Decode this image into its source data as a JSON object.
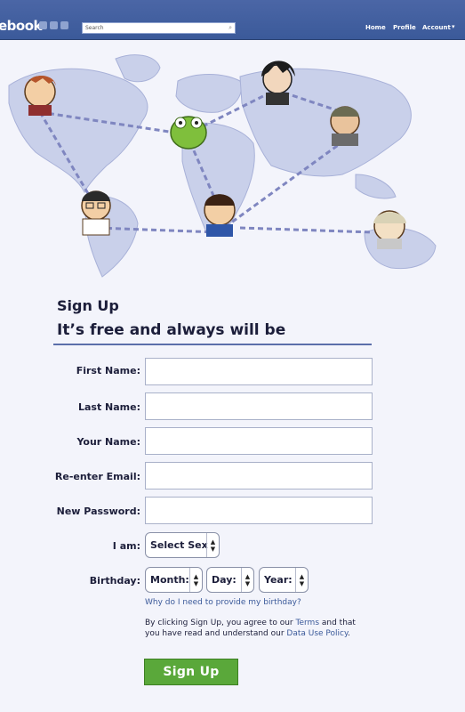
{
  "topbar": {
    "logo": "ebook",
    "search_placeholder": "Search",
    "nav": {
      "home": "Home",
      "profile": "Profile",
      "account": "Account",
      "account_caret": "▾"
    }
  },
  "headings": {
    "signup": "Sign Up",
    "tagline": "It’s free and always will be"
  },
  "form": {
    "first_name_label": "First Name:",
    "last_name_label": "Last Name:",
    "your_name_label": "Your Name:",
    "reenter_email_label": "Re-enter Email:",
    "new_password_label": "New Password:",
    "i_am_label": "I am:",
    "sex_select": "Select Sex",
    "birthday_label": "Birthday:",
    "month_select": "Month:",
    "day_select": "Day:",
    "year_select": "Year:",
    "why_birthday": "Why do I need to provide my birthday?",
    "terms_prefix": "By clicking Sign Up, you agree to our ",
    "terms_link": "Terms",
    "terms_middle": " and that you have read and understand our ",
    "policy_link": "Data Use Policy",
    "terms_suffix": ".",
    "submit": "Sign Up"
  },
  "colors": {
    "topbar": "#3b5a9a",
    "map_land": "#c9d0ea",
    "route_dash": "#7f86c0",
    "button_green": "#5aa83a"
  }
}
